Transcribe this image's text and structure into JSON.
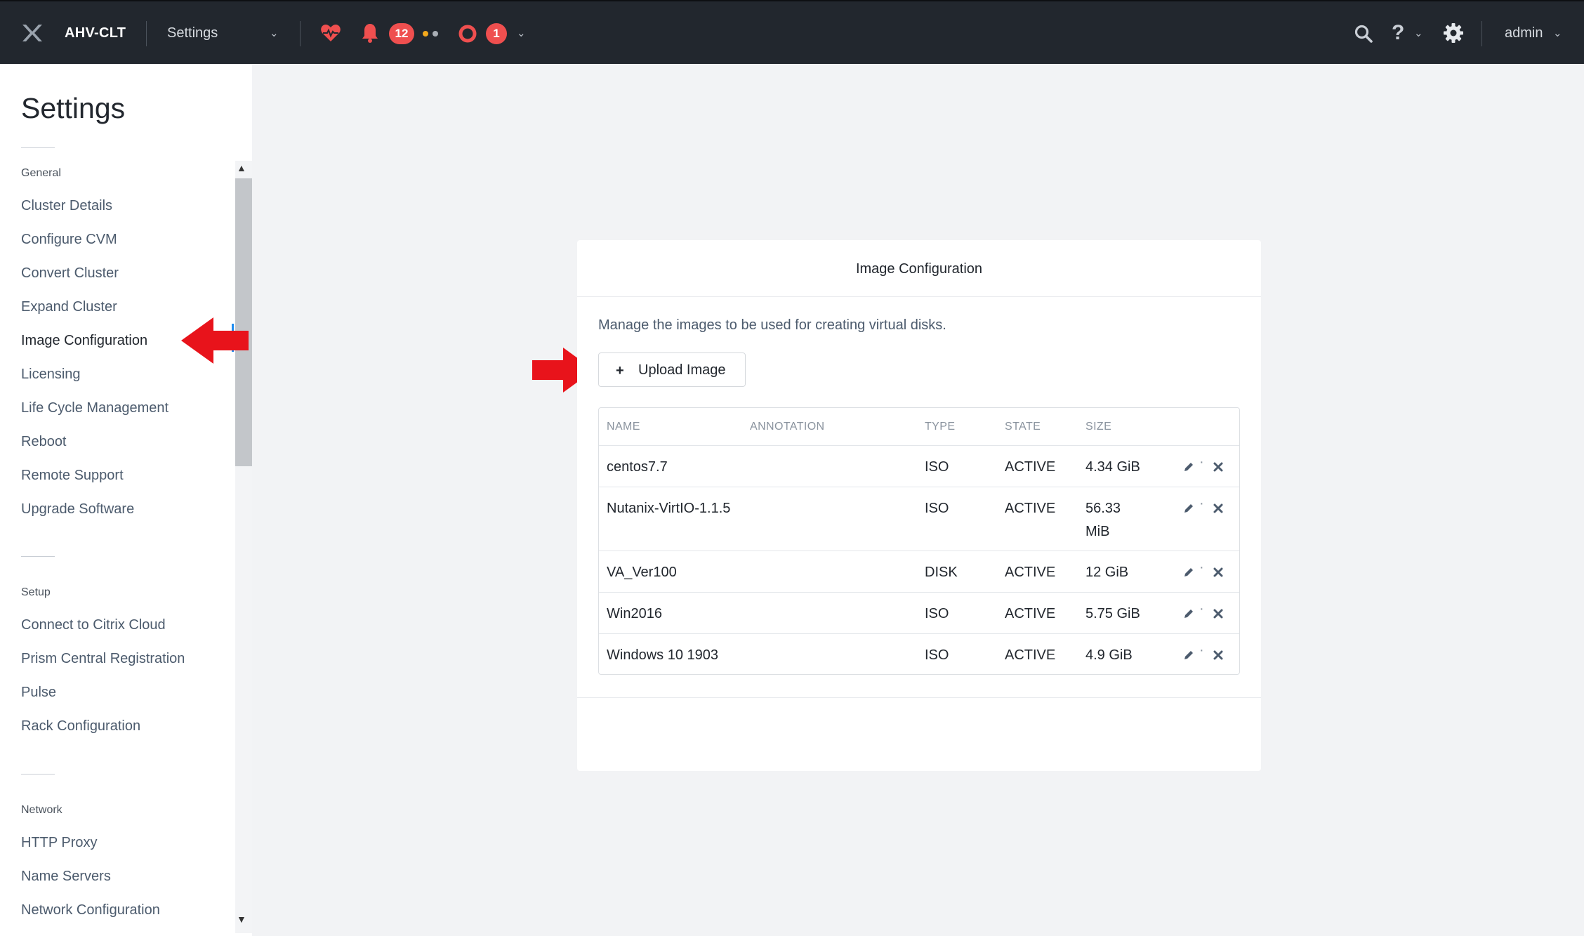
{
  "header": {
    "cluster_name": "AHV-CLT",
    "nav_label": "Settings",
    "alert_count": "12",
    "event_count": "1",
    "user": "admin"
  },
  "sidebar": {
    "title": "Settings",
    "sections": [
      {
        "heading": "General",
        "items": [
          "Cluster Details",
          "Configure CVM",
          "Convert Cluster",
          "Expand Cluster",
          "Image Configuration",
          "Licensing",
          "Life Cycle Management",
          "Reboot",
          "Remote Support",
          "Upgrade Software"
        ]
      },
      {
        "heading": "Setup",
        "items": [
          "Connect to Citrix Cloud",
          "Prism Central Registration",
          "Pulse",
          "Rack Configuration"
        ]
      },
      {
        "heading": "Network",
        "items": [
          "HTTP Proxy",
          "Name Servers",
          "Network Configuration"
        ]
      }
    ],
    "active_item": "Image Configuration"
  },
  "panel": {
    "title": "Image Configuration",
    "description": "Manage the images to be used for creating virtual disks.",
    "upload_label": "Upload Image",
    "columns": [
      "NAME",
      "ANNOTATION",
      "TYPE",
      "STATE",
      "SIZE"
    ],
    "rows": [
      {
        "name": "centos7.7",
        "annotation": "",
        "type": "ISO",
        "state": "ACTIVE",
        "size": "4.34 GiB"
      },
      {
        "name": "Nutanix-VirtIO-1.1.5",
        "annotation": "",
        "type": "ISO",
        "state": "ACTIVE",
        "size": "56.33 MiB"
      },
      {
        "name": "VA_Ver100",
        "annotation": "",
        "type": "DISK",
        "state": "ACTIVE",
        "size": "12 GiB"
      },
      {
        "name": "Win2016",
        "annotation": "",
        "type": "ISO",
        "state": "ACTIVE",
        "size": "5.75 GiB"
      },
      {
        "name": "Windows 10 1903",
        "annotation": "",
        "type": "ISO",
        "state": "ACTIVE",
        "size": "4.9 GiB"
      }
    ]
  },
  "colors": {
    "topbar": "#22272e",
    "badge": "#ef4f4f",
    "annotation_arrow": "#e8131b",
    "active_marker": "#1e8cf0"
  }
}
